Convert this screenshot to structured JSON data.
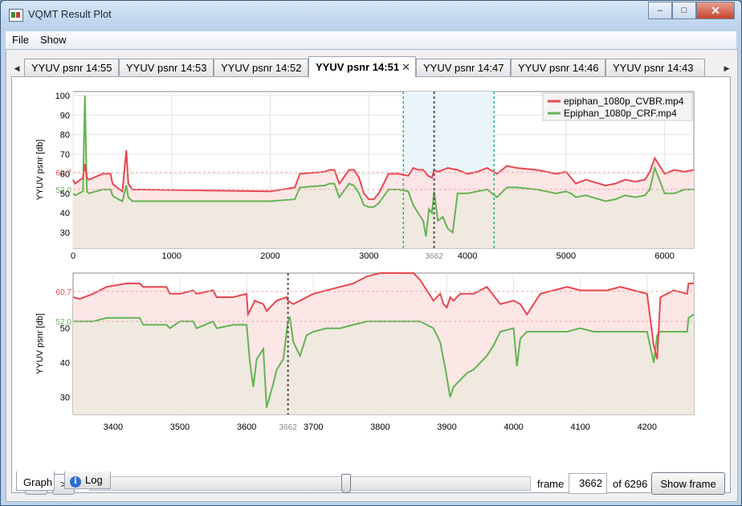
{
  "window": {
    "title": "VQMT Result Plot",
    "minimize": "–",
    "maximize": "□",
    "close": "✕"
  },
  "menu": {
    "file": "File",
    "show": "Show"
  },
  "tabs": [
    {
      "label": "YYUV psnr 14:55"
    },
    {
      "label": "YYUV psnr 14:53"
    },
    {
      "label": "YYUV psnr 14:52"
    },
    {
      "label": "YYUV psnr 14:51",
      "active": true
    },
    {
      "label": "YYUV psnr 14:47"
    },
    {
      "label": "YYUV psnr 14:46"
    },
    {
      "label": "YYUV psnr 14:43"
    }
  ],
  "tab_close": "✕",
  "tab_scroll": {
    "left": "◀",
    "right": "▶"
  },
  "colors": {
    "red": "#e8474f",
    "green": "#63b454",
    "redfill": "#fde3e3",
    "greenfill": "#efe9df",
    "selection": "#eaf5fa",
    "selectionBorder": "#14b87a"
  },
  "chart_data": [
    {
      "type": "line",
      "ylabel": "YYUV psnr [db]",
      "xlim": [
        0,
        6296
      ],
      "ylim": [
        22,
        102
      ],
      "xticks": [
        0,
        1000,
        2000,
        3000,
        4000,
        5000,
        6000
      ],
      "yticks": [
        30,
        40,
        50,
        60,
        70,
        80,
        90,
        100
      ],
      "mean_labels": [
        "60.7",
        "52.0"
      ],
      "cursor": {
        "x": 3662,
        "label": "3662"
      },
      "selection": [
        3350,
        4270
      ],
      "legend": [
        "epiphan_1080p_CVBR.mp4",
        "Epiphan_1080p_CRF.mp4"
      ],
      "series": [
        {
          "name": "epiphan_1080p_CVBR.mp4",
          "x": [
            0,
            20,
            100,
            120,
            140,
            160,
            300,
            380,
            400,
            420,
            500,
            540,
            560,
            600,
            2000,
            2250,
            2300,
            2550,
            2600,
            2650,
            2700,
            2800,
            2850,
            2900,
            2950,
            3000,
            3050,
            3100,
            3200,
            3300,
            3400,
            3450,
            3500,
            3550,
            3600,
            3640,
            3662,
            3700,
            3800,
            3900,
            4000,
            4100,
            4200,
            4300,
            4400,
            4500,
            4700,
            4800,
            4900,
            5000,
            5050,
            5100,
            5200,
            5400,
            5500,
            5600,
            5700,
            5800,
            5850,
            5900,
            6000,
            6100,
            6200,
            6296
          ],
          "y": [
            57,
            55,
            58,
            65,
            58,
            57,
            60,
            60,
            55,
            54,
            51,
            72,
            55,
            52,
            51,
            53,
            60,
            61,
            62,
            62,
            55,
            62,
            62,
            58,
            50,
            47,
            47,
            50,
            60,
            60,
            59,
            63,
            62,
            62,
            59,
            58,
            62,
            61,
            63,
            62,
            60,
            61,
            63,
            60,
            64,
            63,
            62,
            61,
            60,
            61,
            58,
            55,
            57,
            54,
            55,
            57,
            56,
            57,
            61,
            68,
            60,
            62,
            61,
            62
          ]
        },
        {
          "name": "Epiphan_1080p_CRF.mp4",
          "x": [
            0,
            20,
            100,
            120,
            140,
            160,
            300,
            380,
            400,
            420,
            500,
            540,
            560,
            600,
            2000,
            2250,
            2300,
            2550,
            2600,
            2650,
            2700,
            2800,
            2850,
            2900,
            2950,
            3000,
            3050,
            3100,
            3200,
            3300,
            3400,
            3450,
            3500,
            3550,
            3580,
            3610,
            3640,
            3662,
            3700,
            3750,
            3800,
            3850,
            3900,
            4000,
            4100,
            4200,
            4300,
            4400,
            4500,
            4700,
            4800,
            4900,
            5000,
            5050,
            5100,
            5200,
            5400,
            5500,
            5600,
            5700,
            5800,
            5850,
            5900,
            6000,
            6100,
            6200,
            6296
          ],
          "y": [
            50,
            49,
            51,
            100,
            51,
            50,
            52,
            52,
            49,
            48,
            46,
            54,
            48,
            46,
            46,
            47,
            53,
            54,
            55,
            55,
            48,
            55,
            54,
            50,
            44,
            43,
            43,
            45,
            52,
            52,
            51,
            44,
            40,
            36,
            28,
            42,
            40,
            51,
            36,
            38,
            32,
            30,
            50,
            50,
            51,
            52,
            48,
            53,
            53,
            52,
            51,
            50,
            51,
            50,
            48,
            49,
            46,
            47,
            49,
            48,
            49,
            52,
            63,
            50,
            50,
            52,
            52
          ]
        }
      ]
    },
    {
      "type": "line",
      "ylabel": "YYUV psnr [db]",
      "xlim": [
        3340,
        4270
      ],
      "ylim": [
        25,
        66
      ],
      "xticks": [
        3400,
        3500,
        3600,
        3700,
        3800,
        3900,
        4000,
        4100,
        4200
      ],
      "yticks": [
        30,
        40,
        50
      ],
      "mean_labels": [
        "60.7",
        "52.0"
      ],
      "cursor": {
        "x": 3662,
        "label": "3662"
      },
      "series": [
        {
          "name": "epiphan_1080p_CVBR.mp4",
          "x": [
            3340,
            3350,
            3370,
            3390,
            3420,
            3440,
            3445,
            3480,
            3485,
            3500,
            3520,
            3525,
            3550,
            3555,
            3580,
            3600,
            3602,
            3610,
            3612,
            3625,
            3630,
            3640,
            3645,
            3660,
            3662,
            3670,
            3680,
            3690,
            3700,
            3720,
            3740,
            3760,
            3780,
            3800,
            3820,
            3830,
            3850,
            3860,
            3870,
            3880,
            3890,
            3895,
            3900,
            3905,
            3910,
            3920,
            3940,
            3960,
            3980,
            4000,
            4010,
            4020,
            4040,
            4060,
            4080,
            4100,
            4120,
            4140,
            4160,
            4180,
            4200,
            4210,
            4215,
            4220,
            4240,
            4260,
            4262,
            4270
          ],
          "y": [
            59,
            58.5,
            60,
            62,
            63,
            63,
            62,
            62,
            60,
            60,
            61,
            60,
            61,
            59,
            59,
            60,
            54,
            57,
            58,
            57,
            55,
            57,
            58,
            59,
            58,
            57,
            58,
            59,
            60,
            61,
            62,
            63,
            65,
            66,
            66,
            66,
            66,
            64,
            61,
            58,
            60,
            57,
            56,
            59,
            58,
            60,
            60,
            62,
            57,
            58,
            57,
            54,
            60,
            61,
            62,
            61,
            61,
            61,
            62,
            61,
            60,
            45,
            41,
            59,
            61,
            60,
            63,
            63
          ]
        },
        {
          "name": "Epiphan_1080p_CRF.mp4",
          "x": [
            3340,
            3350,
            3370,
            3390,
            3420,
            3440,
            3445,
            3480,
            3485,
            3500,
            3520,
            3525,
            3550,
            3555,
            3580,
            3600,
            3605,
            3610,
            3615,
            3625,
            3630,
            3640,
            3645,
            3655,
            3662,
            3665,
            3670,
            3680,
            3690,
            3700,
            3720,
            3740,
            3760,
            3780,
            3800,
            3820,
            3840,
            3860,
            3880,
            3890,
            3898,
            3905,
            3910,
            3920,
            3930,
            3940,
            3950,
            3960,
            3970,
            3980,
            4000,
            4005,
            4010,
            4020,
            4040,
            4060,
            4080,
            4100,
            4120,
            4140,
            4160,
            4180,
            4200,
            4210,
            4215,
            4220,
            4240,
            4260,
            4262,
            4270
          ],
          "y": [
            52,
            52,
            52,
            53,
            53,
            53,
            51,
            51,
            50,
            52,
            52,
            50,
            52,
            50,
            51,
            51,
            40,
            33,
            41,
            44,
            27,
            34,
            38,
            41,
            52,
            53,
            46,
            42,
            48,
            49,
            50,
            50,
            51,
            52,
            52,
            52,
            52,
            52,
            50,
            46,
            38,
            30,
            33,
            35,
            37,
            38,
            40,
            42,
            45,
            49,
            50,
            39,
            47,
            49,
            49,
            49,
            49,
            50,
            49,
            49,
            49,
            49,
            49,
            40,
            48,
            49,
            49,
            49,
            53,
            54
          ]
        }
      ]
    }
  ],
  "controls": {
    "prev": "<",
    "next": ">",
    "frame_label": "frame",
    "frame_value": "3662",
    "of_label": "of 6296",
    "show_frame": "Show frame",
    "slider_fraction": 0.5816
  },
  "bottom_tabs": {
    "graph": "Graph",
    "log": "Log"
  }
}
